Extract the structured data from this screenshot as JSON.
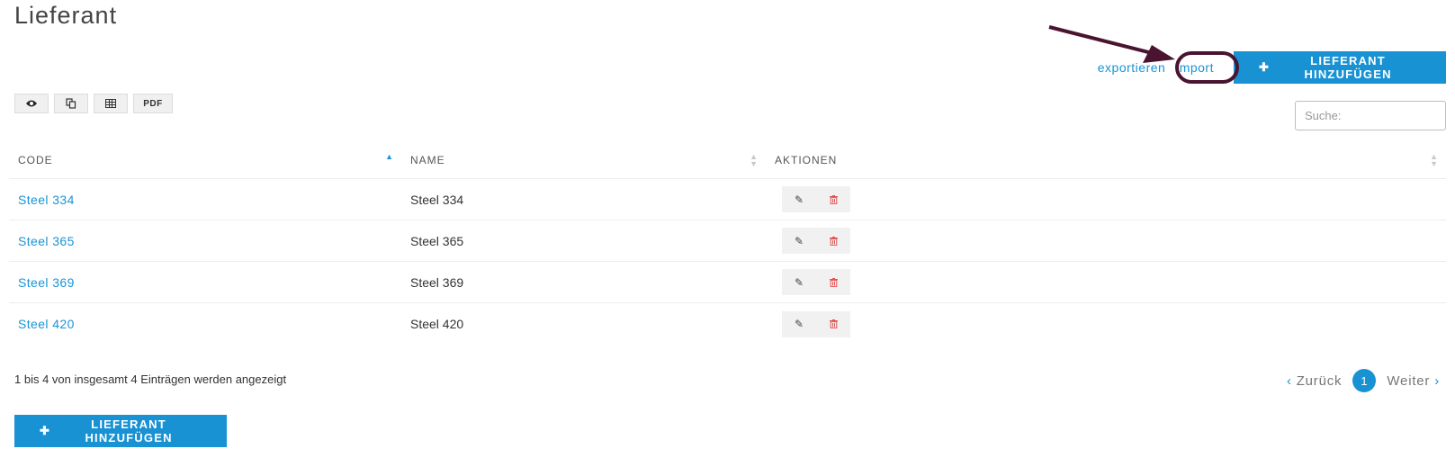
{
  "page": {
    "title": "Lieferant"
  },
  "toolbar": {
    "export_label": "exportieren",
    "import_label": "Import",
    "add_label": "LIEFERANT HINZUFÜGEN",
    "add_icon": "plus-icon"
  },
  "tools": {
    "view_icon": "eye-icon",
    "copy_icon": "copy-icon",
    "excel_icon": "table-icon",
    "pdf_label": "PDF"
  },
  "search": {
    "placeholder": "Suche:"
  },
  "table": {
    "headers": [
      "CODE",
      "NAME",
      "AKTIONEN"
    ],
    "rows": [
      {
        "code": "Steel 334",
        "name": "Steel 334"
      },
      {
        "code": "Steel 365",
        "name": "Steel 365"
      },
      {
        "code": "Steel 369",
        "name": "Steel 369"
      },
      {
        "code": "Steel 420",
        "name": "Steel 420"
      }
    ],
    "action_icons": [
      "edit-icon",
      "trash-icon"
    ]
  },
  "footer": {
    "info": "1 bis 4 von insgesamt 4 Einträgen werden angezeigt",
    "prev_label": "Zurück",
    "next_label": "Weiter",
    "current_page": "1",
    "add_label": "LIEFERANT HINZUFÜGEN"
  },
  "colors": {
    "accent": "#1992d4",
    "annotation": "#4a1430",
    "delete": "#e05555"
  }
}
